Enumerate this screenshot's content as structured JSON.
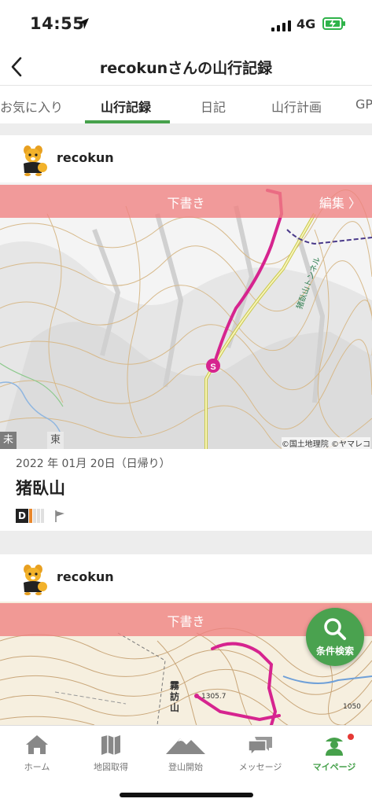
{
  "status": {
    "time": "14:55",
    "network": "4G"
  },
  "nav": {
    "title": "recokunさんの山行記録"
  },
  "tabs": [
    {
      "label": "お気に入り"
    },
    {
      "label": "山行記録"
    },
    {
      "label": "日記"
    },
    {
      "label": "山行計画"
    },
    {
      "label": "GPS"
    }
  ],
  "records": [
    {
      "user": "recokun",
      "draft_label": "下書き",
      "edit_label": "編集 〉",
      "tags": [
        "未設定",
        "東海"
      ],
      "copyright": "©国土地理院 ©ヤマレコ",
      "date": "2022 年 01月 20日（日帰り）",
      "mountain": "猪臥山",
      "difficulty": "D",
      "map_labels": {
        "tunnel": "猪臥山トンネル"
      }
    },
    {
      "user": "recokun",
      "draft_label": "下書き",
      "map_labels": {
        "peak": "霧訪山",
        "elevation1": "1305.7",
        "elevation2": "1050"
      }
    }
  ],
  "fab": {
    "label": "条件検索",
    "icon": "search-icon"
  },
  "bottom_nav": [
    {
      "label": "ホーム",
      "icon": "home-icon"
    },
    {
      "label": "地図取得",
      "icon": "map-icon"
    },
    {
      "label": "登山開始",
      "icon": "mountain-icon"
    },
    {
      "label": "メッセージ",
      "icon": "message-icon"
    },
    {
      "label": "マイページ",
      "icon": "mypage-icon"
    }
  ],
  "colors": {
    "accent": "#46a14b",
    "draft": "#f08080",
    "route": "#d6248f"
  }
}
